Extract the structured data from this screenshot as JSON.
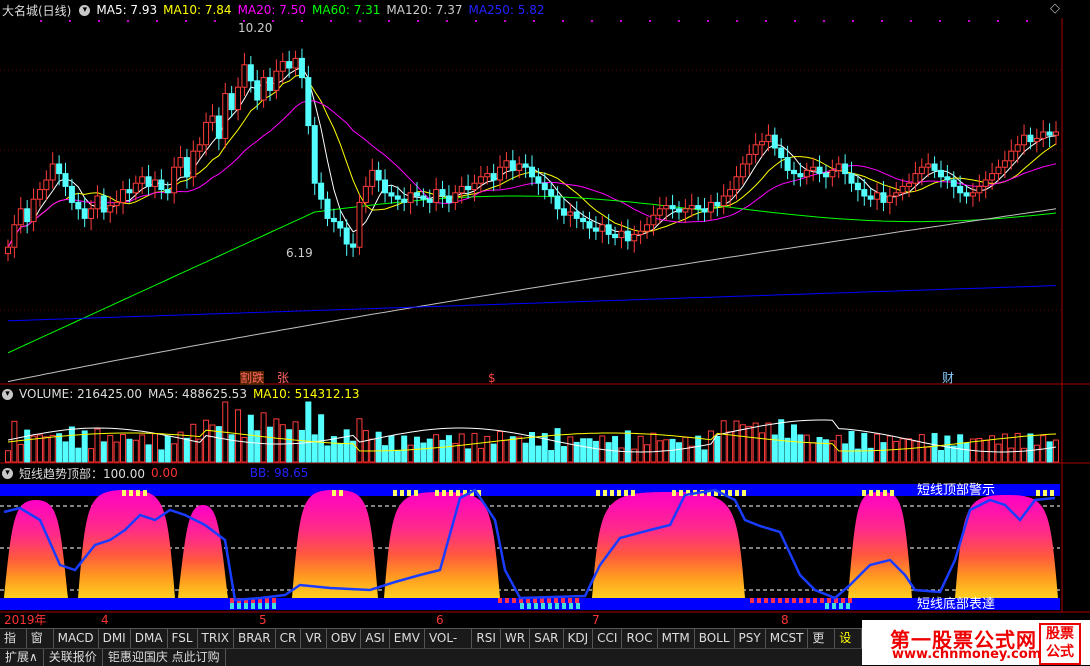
{
  "main_header": {
    "title": "大名城(日线)",
    "ma5": "MA5: 7.93",
    "ma10": "MA10: 7.84",
    "ma20": "MA20: 7.50",
    "ma60": "MA60: 7.31",
    "ma120": "MA120: 7.37",
    "ma250": "MA250: 5.82"
  },
  "annotations": {
    "high": "10.20",
    "low": "6.19",
    "ev1": "割跌",
    "ev2": "张",
    "ev3": "$",
    "ev4": "财"
  },
  "volume_header": {
    "volume": "VOLUME: 216425.00",
    "ma5": "MA5: 488625.53",
    "ma10": "MA10: 514312.13"
  },
  "indicator_header": {
    "name": "短线趋势顶部：100.00",
    "v2": "0.00",
    "bb": "BB: 98.65"
  },
  "indicator_labels": {
    "top": "短线顶部警示",
    "bottom": "短线底部表達"
  },
  "xaxis": [
    "2019年",
    "4",
    "5",
    "6",
    "7",
    "8"
  ],
  "tabs": [
    "指标",
    "窗口",
    "MACD",
    "DMI",
    "DMA",
    "FSL",
    "TRIX",
    "BRAR",
    "CR",
    "VR",
    "OBV",
    "ASI",
    "EMV",
    "VOL-TDX",
    "RSI",
    "WR",
    "SAR",
    "KDJ",
    "CCI",
    "ROC",
    "MTM",
    "BOLL",
    "PSY",
    "MCST",
    "更多",
    "设置"
  ],
  "tabs2": [
    "扩展∧",
    "关联报价",
    "钜惠迎国庆 点此订购"
  ],
  "brand": {
    "title": "第一股票公式网",
    "url": "www.chnmoney.com",
    "box": "股票 公式"
  },
  "colors": {
    "up": "#ff3c3c",
    "down": "#54ffff",
    "ma5": "#ffffff",
    "ma10": "#ffff00",
    "ma20": "#ff00ff",
    "ma60": "#00ff00",
    "ma120": "#c0c0c0",
    "ma250": "#0000ff"
  },
  "chart_data": {
    "type": "candlestick",
    "closes": [
      6.95,
      7.3,
      7.55,
      7.35,
      7.7,
      7.85,
      8.0,
      8.25,
      8.1,
      7.9,
      7.65,
      7.55,
      7.4,
      7.55,
      7.75,
      7.5,
      7.6,
      7.65,
      7.85,
      7.8,
      7.95,
      8.05,
      7.9,
      8.0,
      7.85,
      7.8,
      8.2,
      8.35,
      8.05,
      8.45,
      8.55,
      8.9,
      9.0,
      8.65,
      9.35,
      9.1,
      9.45,
      9.8,
      9.55,
      9.25,
      9.6,
      9.4,
      9.7,
      9.85,
      9.75,
      9.9,
      9.6,
      8.85,
      7.95,
      7.7,
      7.4,
      7.35,
      7.25,
      7.0,
      6.95,
      7.65,
      7.9,
      8.15,
      8.0,
      7.8,
      7.75,
      7.7,
      7.65,
      7.8,
      7.75,
      7.7,
      7.65,
      7.85,
      7.75,
      7.65,
      7.8,
      7.9,
      7.85,
      7.95,
      8.05,
      8.1,
      8.0,
      8.2,
      8.3,
      8.15,
      8.25,
      8.2,
      8.05,
      7.95,
      7.85,
      7.75,
      7.55,
      7.45,
      7.5,
      7.4,
      7.35,
      7.25,
      7.2,
      7.3,
      7.15,
      7.1,
      7.2,
      7.05,
      7.15,
      7.2,
      7.3,
      7.45,
      7.55,
      7.6,
      7.55,
      7.5,
      7.55,
      7.6,
      7.55,
      7.5,
      7.65,
      7.6,
      7.75,
      7.85,
      8.05,
      8.25,
      8.4,
      8.55,
      8.6,
      8.7,
      8.5,
      8.35,
      8.15,
      8.1,
      8.05,
      8.15,
      8.2,
      8.1,
      8.05,
      8.15,
      8.25,
      8.1,
      7.95,
      7.85,
      7.75,
      7.7,
      7.8,
      7.65,
      7.75,
      7.8,
      7.9,
      7.95,
      8.1,
      8.2,
      8.25,
      8.15,
      8.05,
      8.0,
      7.9,
      7.8,
      7.75,
      7.8,
      7.9,
      8.0,
      8.1,
      8.2,
      8.3,
      8.45,
      8.55,
      8.7,
      8.6,
      8.65,
      8.75,
      8.7,
      8.75
    ]
  }
}
